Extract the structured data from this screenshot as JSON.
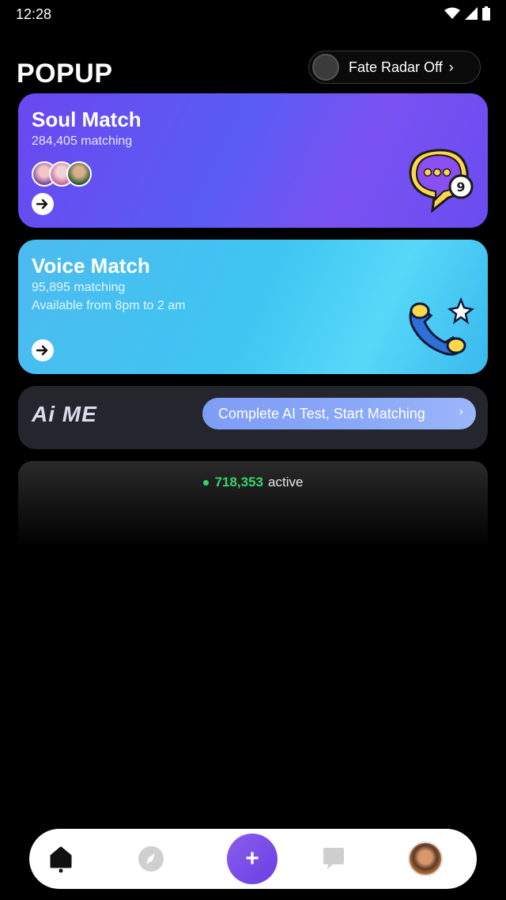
{
  "status": {
    "time": "12:28",
    "icons": [
      "wifi-icon",
      "signal-icon",
      "battery-icon"
    ]
  },
  "header": {
    "title": "POPUP",
    "radar_label": "Fate Radar Off",
    "radar_chevron": "›"
  },
  "soul_match": {
    "title": "Soul Match",
    "count_text": "284,405 matching",
    "icon": "chat-bubble-icon"
  },
  "voice_match": {
    "title": "Voice Match",
    "count_text": "95,895 matching",
    "hours_text": "Available from 8pm to 2 am",
    "icon": "phone-icon"
  },
  "aime": {
    "logo": "Ai ME",
    "button_label": "Complete AI Test, Start Matching",
    "button_chevron": "›"
  },
  "active": {
    "count": "718,353",
    "label": "active"
  },
  "nav": {
    "items": [
      "home-icon",
      "compass-icon",
      "plus-icon",
      "message-icon",
      "profile-avatar"
    ],
    "plus_label": "+"
  },
  "colors": {
    "soul_card": "#6a48f0",
    "voice_card": "#4cbbf0",
    "aime_button": "#8aa9f8",
    "active_green": "#3ad16a",
    "plus_button": "#7a4ce8"
  }
}
